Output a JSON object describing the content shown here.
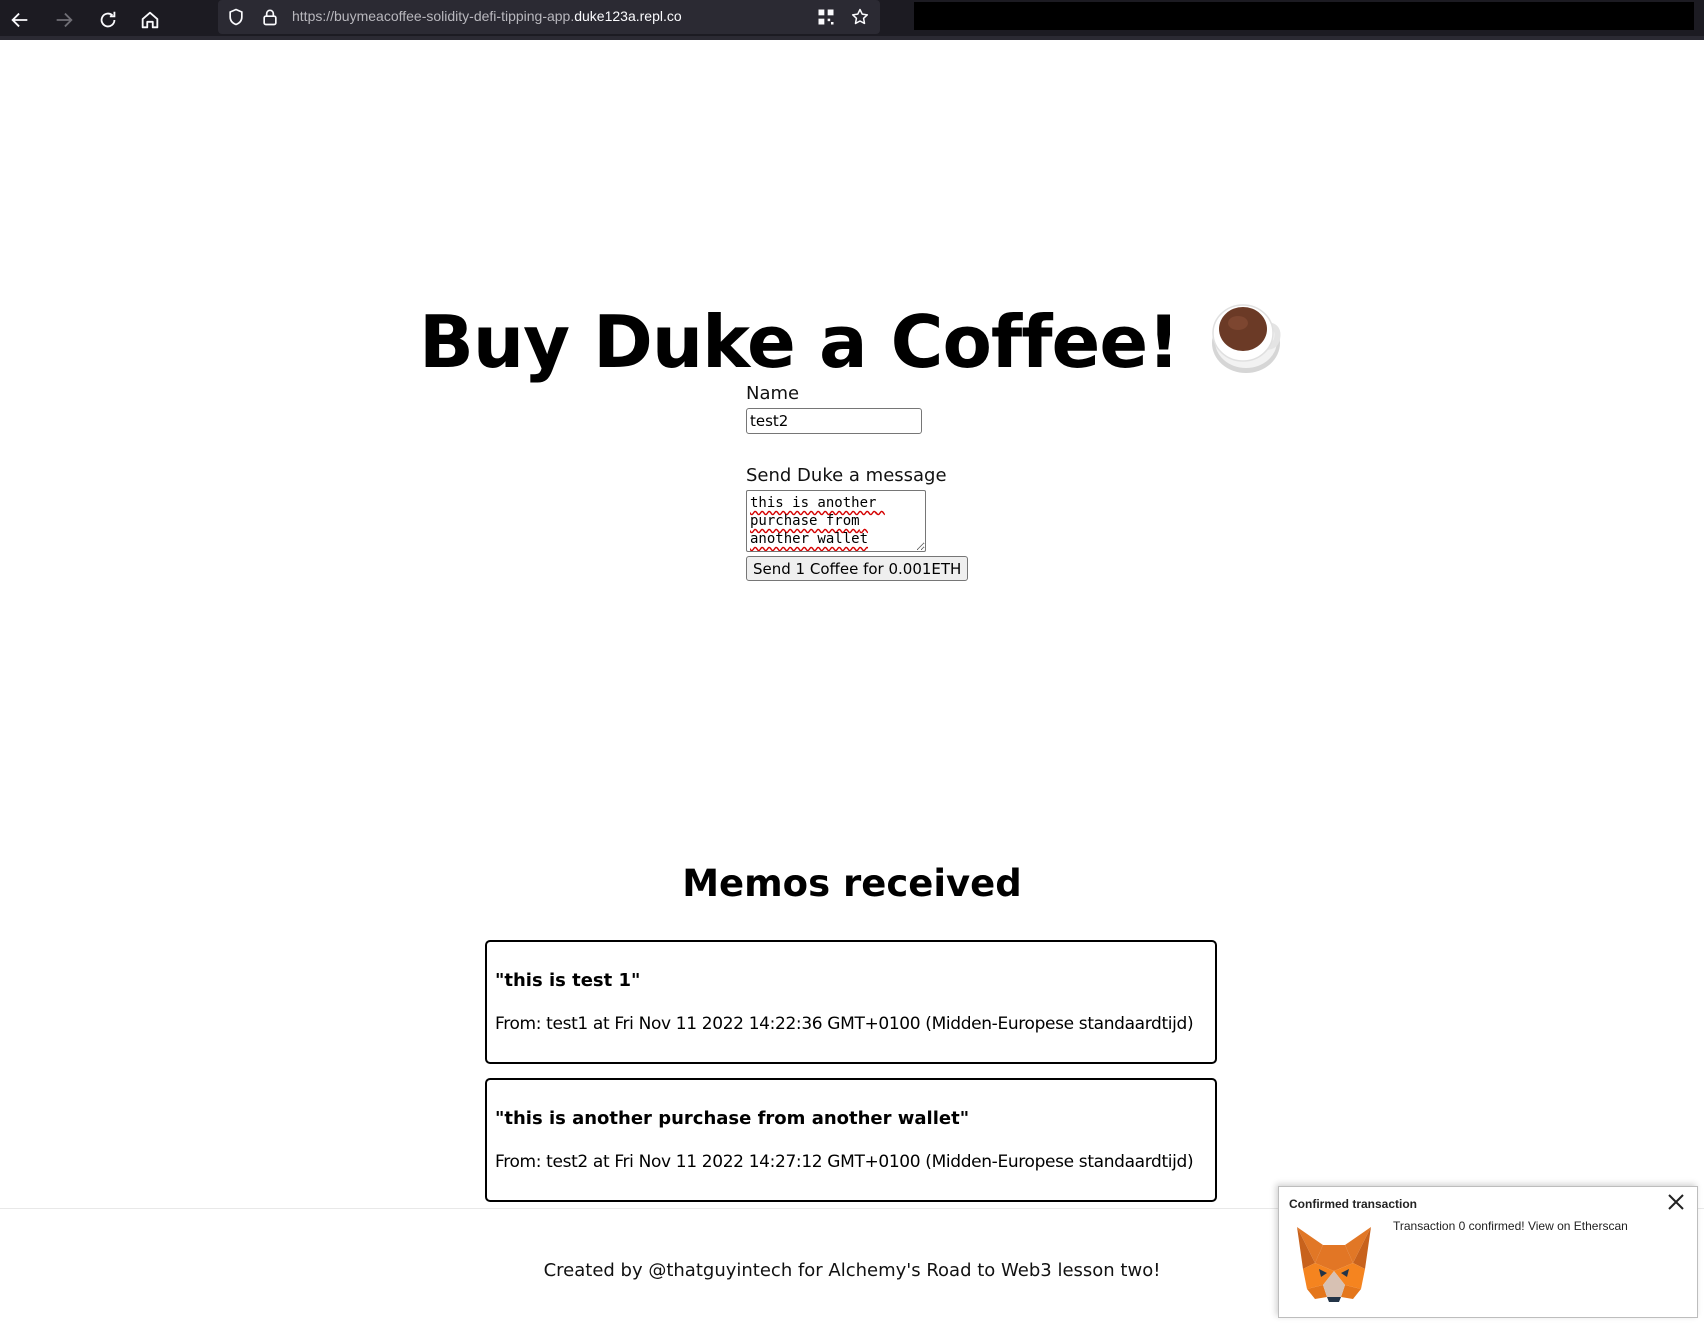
{
  "browser": {
    "url_prefix": "https://buymeacoffee-solidity-defi-tipping-app.",
    "url_domain": "duke123a.repl.co",
    "icons": [
      "back-icon",
      "forward-icon",
      "reload-icon",
      "home-icon",
      "shield-icon",
      "lock-icon",
      "qr-code-icon",
      "bookmark-star-icon"
    ]
  },
  "header": {
    "title": "Buy Duke a Coffee!",
    "title_icon": "hot-beverage-emoji-icon"
  },
  "form": {
    "name_label": "Name",
    "name_value": "test2",
    "message_label": "Send Duke a message",
    "message_value": "this is another purchase from another wallet",
    "send_button": "Send 1 Coffee for 0.001ETH"
  },
  "memos": {
    "title": "Memos received",
    "items": [
      {
        "message": "\"this is test 1\"",
        "from": "From: test1 at Fri Nov 11 2022 14:22:36 GMT+0100 (Midden-Europese standaardtijd)"
      },
      {
        "message": "\"this is another purchase from another wallet\"",
        "from": "From: test2 at Fri Nov 11 2022 14:27:12 GMT+0100 (Midden-Europese standaardtijd)"
      }
    ]
  },
  "footer": {
    "text": "Created by @thatguyintech for Alchemy's Road to Web3 lesson two!"
  },
  "notification": {
    "title": "Confirmed transaction",
    "body": "Transaction 0 confirmed! View on Etherscan",
    "icon": "metamask-fox-icon"
  },
  "colors": {
    "chrome_bg": "#1c1b22",
    "urlbar_bg": "#2b2a33",
    "coffee": "#6b3a26"
  }
}
